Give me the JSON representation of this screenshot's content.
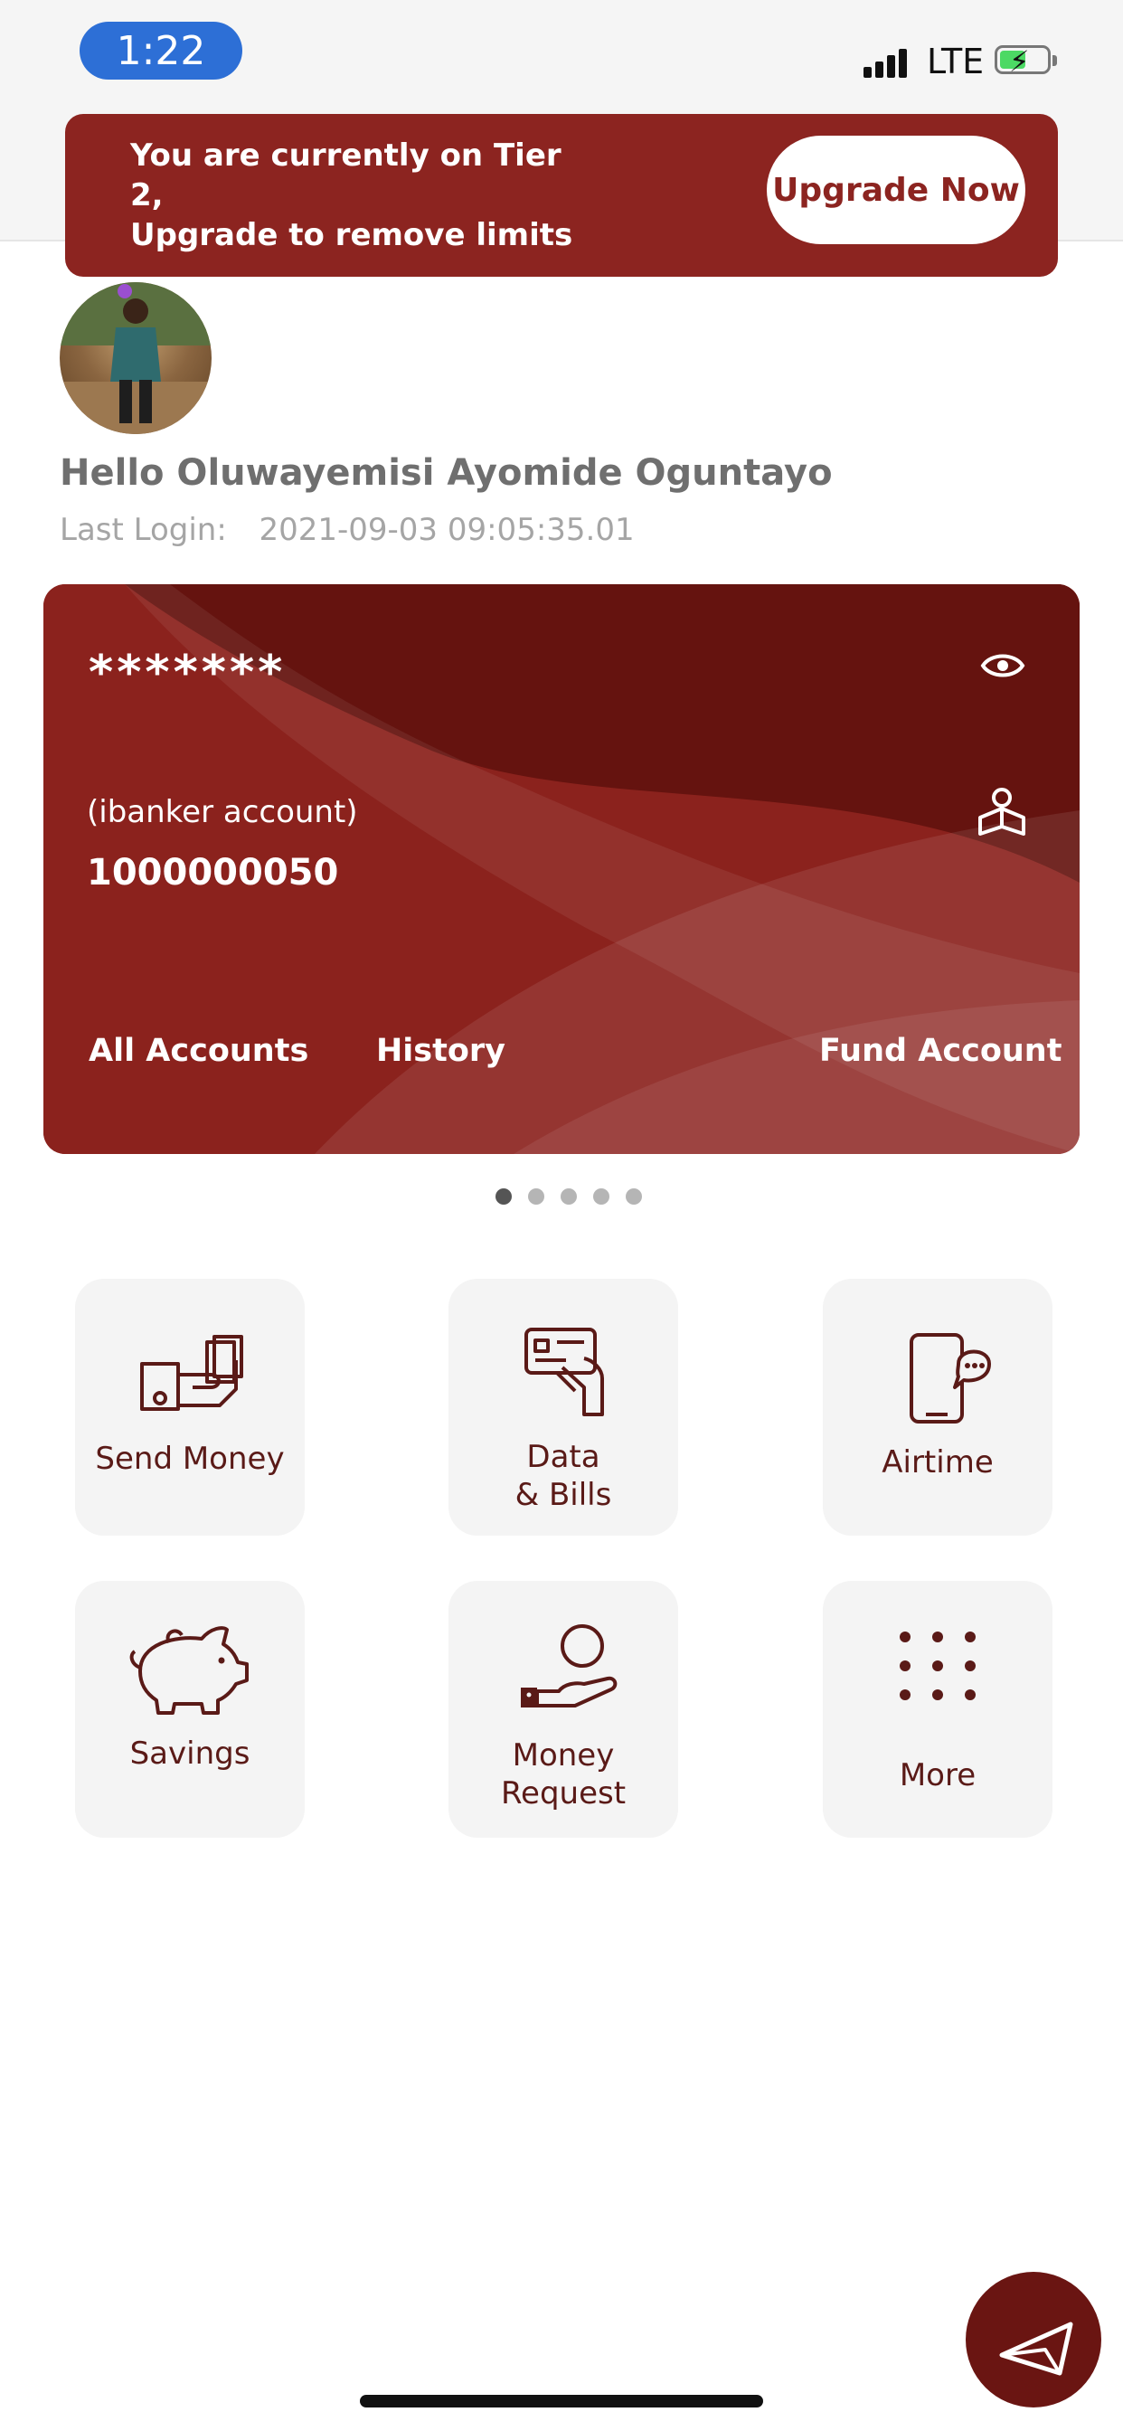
{
  "status_bar": {
    "time": "1:22",
    "network": "LTE"
  },
  "banner": {
    "line1": "You are currently on Tier 2,",
    "line2": "Upgrade to remove limits",
    "button": "Upgrade Now"
  },
  "user": {
    "greeting": "Hello Oluwayemisi Ayomide Oguntayo",
    "last_login_label": "Last Login:",
    "last_login_value": "2021-09-03 09:05:35.01"
  },
  "card": {
    "balance_masked": "*******",
    "account_type": "(ibanker account)",
    "account_number": "1000000050",
    "links": {
      "all_accounts": "All Accounts",
      "history": "History",
      "fund_account": "Fund Account"
    }
  },
  "carousel": {
    "count": 5,
    "active_index": 0
  },
  "actions": [
    {
      "label": "Send Money",
      "icon": "money-hand-icon"
    },
    {
      "label": "Data",
      "label2": "& Bills",
      "icon": "card-hand-icon"
    },
    {
      "label": "Airtime",
      "icon": "phone-chat-icon"
    },
    {
      "label": "Savings",
      "icon": "piggy-bank-icon"
    },
    {
      "label": "Money",
      "label2": "Request",
      "icon": "coin-hand-icon"
    },
    {
      "label": "More",
      "icon": "dot-grid-icon"
    }
  ],
  "colors": {
    "brand": "#8c2420",
    "card_dark": "#6a1512",
    "tile_bg": "#f4f4f4",
    "icon": "#5a1a17"
  }
}
